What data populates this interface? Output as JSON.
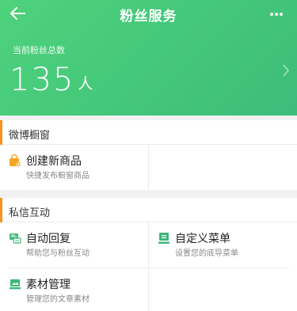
{
  "header": {
    "title": "粉丝服务",
    "back_icon": "back-arrow-icon",
    "more_icon": "more-dots-icon"
  },
  "fans": {
    "label": "当前粉丝总数",
    "count": "135",
    "unit": "人"
  },
  "sections": [
    {
      "title": "微博橱窗",
      "items": [
        {
          "title": "创建新商品",
          "desc": "快捷发布橱窗商品",
          "icon": "shopping-bag-icon"
        }
      ]
    },
    {
      "title": "私信互动",
      "items": [
        {
          "title": "自动回复",
          "desc": "帮助您与粉丝互动",
          "icon": "auto-reply-icon"
        },
        {
          "title": "自定义菜单",
          "desc": "设置您的底导菜单",
          "icon": "custom-menu-icon"
        },
        {
          "title": "素材管理",
          "desc": "管理您的文章素材",
          "icon": "material-icon"
        }
      ]
    }
  ],
  "colors": {
    "hero_green": "#45c97a",
    "section_accent": "#f7931e",
    "icon_orange": "#f5a623",
    "icon_green": "#3cb878"
  }
}
